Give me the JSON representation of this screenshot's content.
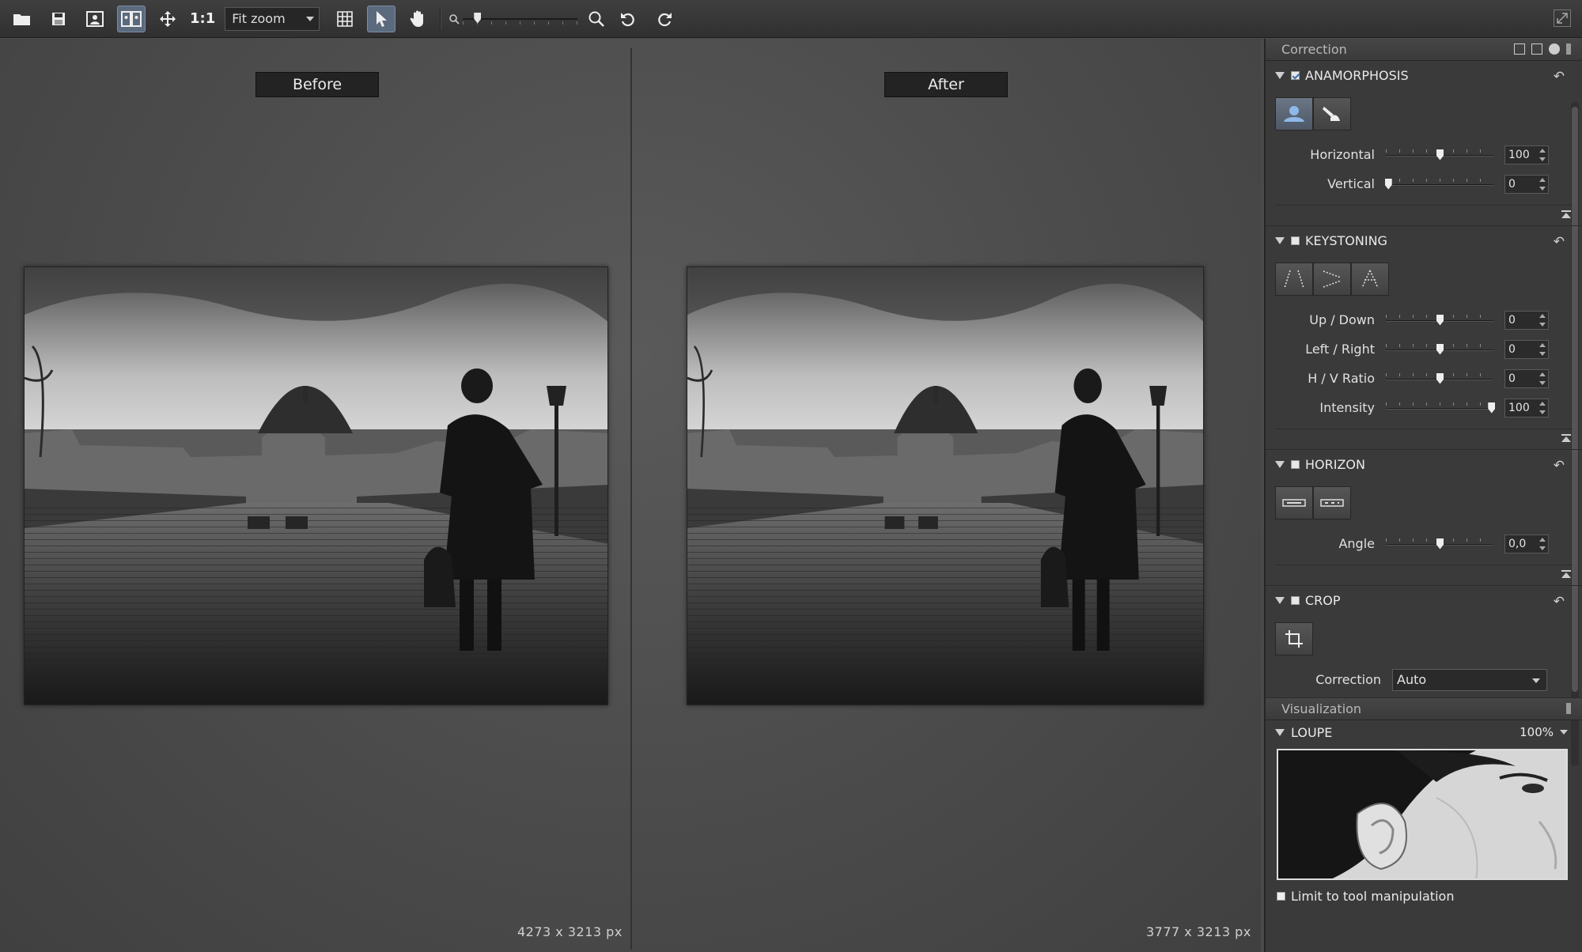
{
  "toolbar": {
    "one_to_one": "1:1",
    "zoom_mode": "Fit zoom",
    "icons": [
      "open-icon",
      "save-icon",
      "single-view-icon",
      "split-view-icon",
      "move-icon",
      "grid-icon",
      "select-pointer-icon",
      "hand-icon",
      "zoom-out-icon",
      "zoom-in-icon",
      "rotate-left-icon",
      "rotate-right-icon",
      "fullscreen-icon"
    ]
  },
  "canvas": {
    "before_label": "Before",
    "after_label": "After",
    "before_dims": "4273 x 3213 px",
    "after_dims": "3777 x 3213 px"
  },
  "correction_panel": {
    "header": "Correction",
    "anamorphosis": {
      "title": "ANAMORPHOSIS",
      "enabled": true,
      "horizontal_label": "Horizontal",
      "horizontal_value": "100",
      "horizontal_level": 0.5,
      "vertical_label": "Vertical",
      "vertical_value": "0",
      "vertical_level": 0.0
    },
    "keystoning": {
      "title": "KEYSTONING",
      "enabled": false,
      "up_down_label": "Up / Down",
      "up_down_value": "0",
      "left_right_label": "Left / Right",
      "left_right_value": "0",
      "hv_ratio_label": "H / V Ratio",
      "hv_ratio_value": "0",
      "intensity_label": "Intensity",
      "intensity_value": "100",
      "intensity_level": 1.0
    },
    "horizon": {
      "title": "HORIZON",
      "enabled": false,
      "angle_label": "Angle",
      "angle_value": "0,0"
    },
    "crop": {
      "title": "CROP",
      "enabled": false,
      "correction_label": "Correction",
      "correction_value": "Auto"
    }
  },
  "visualization_panel": {
    "header": "Visualization",
    "loupe_title": "LOUPE",
    "loupe_zoom": "100%",
    "limit_label": "Limit to tool manipulation"
  }
}
